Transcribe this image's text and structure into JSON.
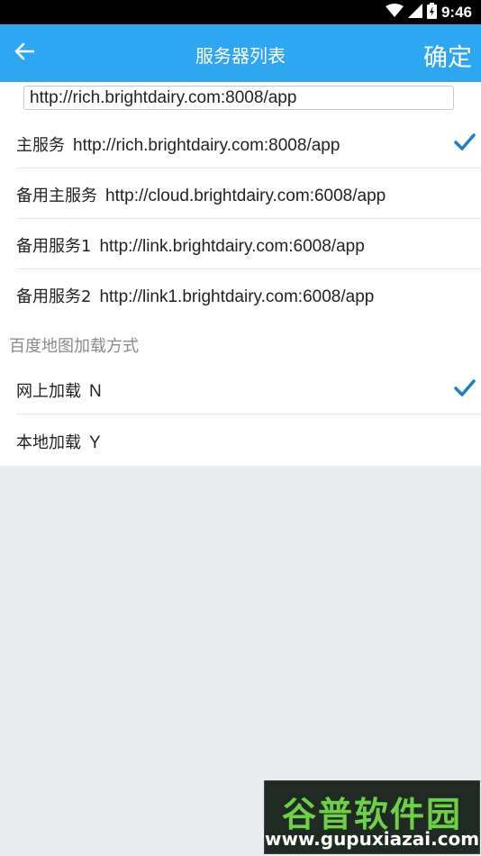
{
  "status_bar": {
    "time": "9:46",
    "icons": [
      "wifi-icon",
      "signal-icon",
      "battery-icon"
    ]
  },
  "app_bar": {
    "back_icon": "back-arrow-icon",
    "title": "服务器列表",
    "confirm_label": "确定"
  },
  "server_input": {
    "value": "http://rich.brightdairy.com:8008/app"
  },
  "servers": [
    {
      "name": "主服务",
      "url": "http://rich.brightdairy.com:8008/app",
      "selected": true
    },
    {
      "name": "备用主服务",
      "url": "http://cloud.brightdairy.com:6008/app",
      "selected": false
    },
    {
      "name": "备用服务1",
      "url": "http://link.brightdairy.com:6008/app",
      "selected": false
    },
    {
      "name": "备用服务2",
      "url": "http://link1.brightdairy.com:6008/app",
      "selected": false
    }
  ],
  "map_section": {
    "header": "百度地图加载方式",
    "options": [
      {
        "label": "网上加载",
        "value": "N",
        "selected": true
      },
      {
        "label": "本地加载",
        "value": "Y",
        "selected": false
      }
    ]
  },
  "watermark": {
    "logo_text": "谷普软件园",
    "url": "www.gupuxiazai.com"
  },
  "colors": {
    "accent": "#2fa6f0",
    "check": "#1e7fc8",
    "background": "#e9edf0"
  }
}
